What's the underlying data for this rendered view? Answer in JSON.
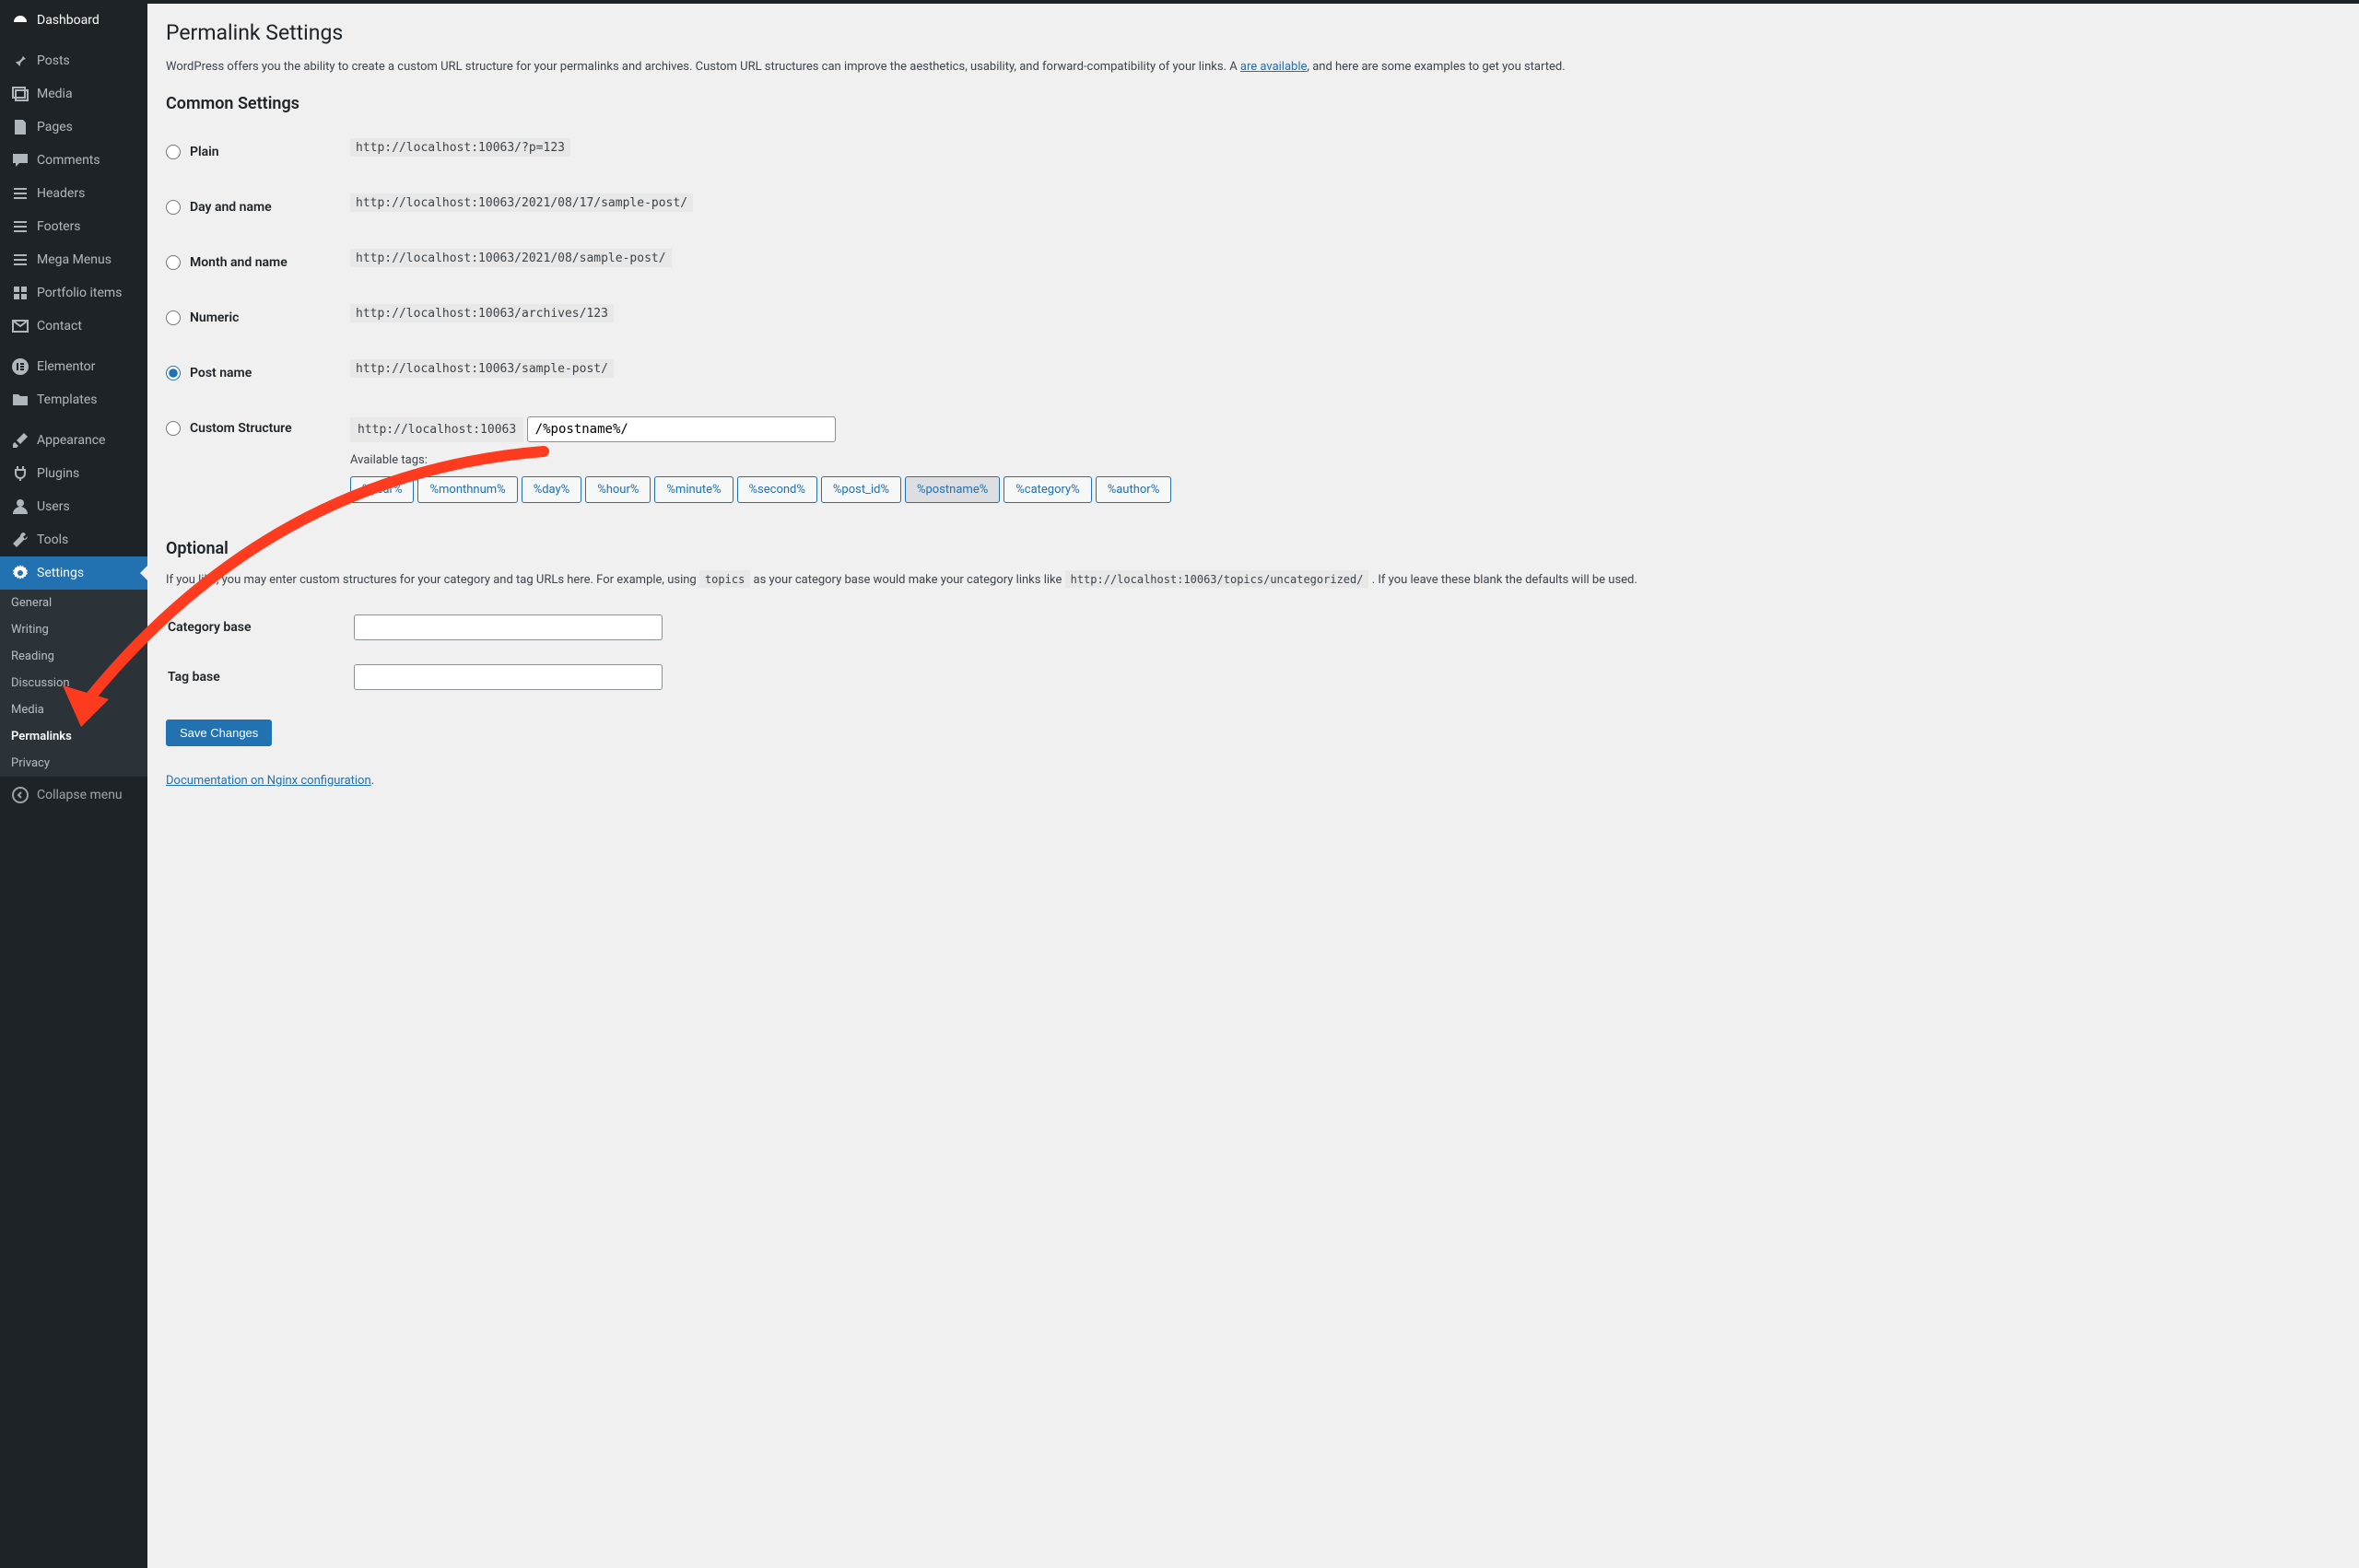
{
  "sidebar": {
    "groups": [
      [
        {
          "icon": "dashboard",
          "label": "Dashboard",
          "top": true
        }
      ],
      [
        {
          "icon": "pin",
          "label": "Posts"
        },
        {
          "icon": "media",
          "label": "Media"
        },
        {
          "icon": "page",
          "label": "Pages"
        },
        {
          "icon": "comment",
          "label": "Comments"
        },
        {
          "icon": "bars",
          "label": "Headers"
        },
        {
          "icon": "bars",
          "label": "Footers"
        },
        {
          "icon": "bars",
          "label": "Mega Menus"
        },
        {
          "icon": "grid",
          "label": "Portfolio items"
        },
        {
          "icon": "mail",
          "label": "Contact"
        }
      ],
      [
        {
          "icon": "elementor",
          "label": "Elementor"
        },
        {
          "icon": "folder",
          "label": "Templates"
        }
      ],
      [
        {
          "icon": "brush",
          "label": "Appearance"
        },
        {
          "icon": "plug",
          "label": "Plugins"
        },
        {
          "icon": "user",
          "label": "Users"
        },
        {
          "icon": "wrench",
          "label": "Tools"
        },
        {
          "icon": "cog",
          "label": "Settings",
          "current": true
        }
      ]
    ],
    "submenu": [
      "General",
      "Writing",
      "Reading",
      "Discussion",
      "Media",
      "Permalinks",
      "Privacy"
    ],
    "submenu_active": "Permalinks",
    "collapse": "Collapse menu"
  },
  "page": {
    "title": "Permalink Settings",
    "intro_a": "WordPress offers you the ability to create a custom URL structure for your permalinks and archives. Custom URL structures can improve the aesthetics, usability, and forward-compatibility of your links. A ",
    "intro_link": "are available",
    "intro_b": ", and here are some examples to get you started.",
    "common_heading": "Common Settings",
    "options": [
      {
        "label": "Plain",
        "example": "http://localhost:10063/?p=123"
      },
      {
        "label": "Day and name",
        "example": "http://localhost:10063/2021/08/17/sample-post/"
      },
      {
        "label": "Month and name",
        "example": "http://localhost:10063/2021/08/sample-post/"
      },
      {
        "label": "Numeric",
        "example": "http://localhost:10063/archives/123"
      },
      {
        "label": "Post name",
        "example": "http://localhost:10063/sample-post/",
        "selected": true
      },
      {
        "label": "Custom Structure",
        "custom": true,
        "prefix": "http://localhost:10063",
        "value": "/%postname%/"
      }
    ],
    "available_label": "Available tags:",
    "tags": [
      "%year%",
      "%monthnum%",
      "%day%",
      "%hour%",
      "%minute%",
      "%second%",
      "%post_id%",
      "%postname%",
      "%category%",
      "%author%"
    ],
    "selected_tag": "%postname%",
    "optional_heading": "Optional",
    "optional_desc_a": "If you like, you may enter custom structures for your category and tag URLs here. For example, using ",
    "optional_code_a": "topics",
    "optional_desc_b": " as your category base would make your category links like ",
    "optional_code_b": "http://localhost:10063/topics/uncategorized/",
    "optional_desc_c": " . If you leave these blank the defaults will be used.",
    "category_base_label": "Category base",
    "tag_base_label": "Tag base",
    "save_label": "Save Changes",
    "doc_link": "Documentation on Nginx configuration"
  }
}
